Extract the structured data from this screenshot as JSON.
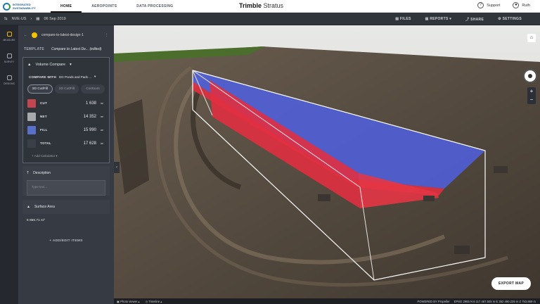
{
  "top": {
    "logo_text": "INTEGRATED SUSTAINABILITY",
    "nav": [
      "HOME",
      "AEROPOINTS",
      "DATA PROCESSING"
    ],
    "brand_bold": "Trimble",
    "brand_light": "Stratus",
    "support": "Support",
    "user": "Ruth"
  },
  "toolbar": {
    "site": "NVE-US",
    "date": "06 Sep 2019",
    "files": "FILES",
    "reports": "REPORTS",
    "share": "SHARE",
    "settings": "SETTINGS"
  },
  "rail": {
    "measure": "MEASURE",
    "survey": "SURVEY",
    "designs": "DESIGNS"
  },
  "panel": {
    "measurement_name": "compare-to-latest-design-1",
    "template_label": "TEMPLATE",
    "template_value": "Compare to Latest De... (edited)",
    "volume_compare": "Volume Compare",
    "compare_with_label": "COMPARE WITH",
    "compare_with_value": "DG Ponds and Pads ...",
    "segments": [
      "3D Cut/Fill",
      "2D Cut/Fill",
      "Contours"
    ],
    "rows": [
      {
        "name": "CUT",
        "value": "1 638",
        "unit": "m³",
        "color": "#c0464f"
      },
      {
        "name": "NET",
        "value": "14 352",
        "unit": "m³",
        "color": "#a7a9ad"
      },
      {
        "name": "FILL",
        "value": "15 990",
        "unit": "m³",
        "color": "#5a6fc7"
      },
      {
        "name": "TOTAL",
        "value": "17 628",
        "unit": "m³",
        "color": "#3b4048"
      }
    ],
    "add_calc": "+ Add Calculator ▾",
    "description_title": "Description",
    "description_placeholder": "Type text...",
    "surface_title": "Surface Area",
    "surface_value": "6 866.71 m²",
    "add_edit": "+ ADD/EDIT ITEMS"
  },
  "viewport": {
    "export": "EXPORT MAP"
  },
  "bottom": {
    "photo_viewer": "Photo viewer",
    "timeline": "Timeline",
    "powered": "POWERED BY Propeller",
    "coords": "EPSG 2955 N 6 117 467.502 m E 352 490.225 m Z 753.869 m"
  },
  "colors": {
    "cut": "#c0464f",
    "fill": "#5a6fc7",
    "accent": "#f5c400"
  }
}
